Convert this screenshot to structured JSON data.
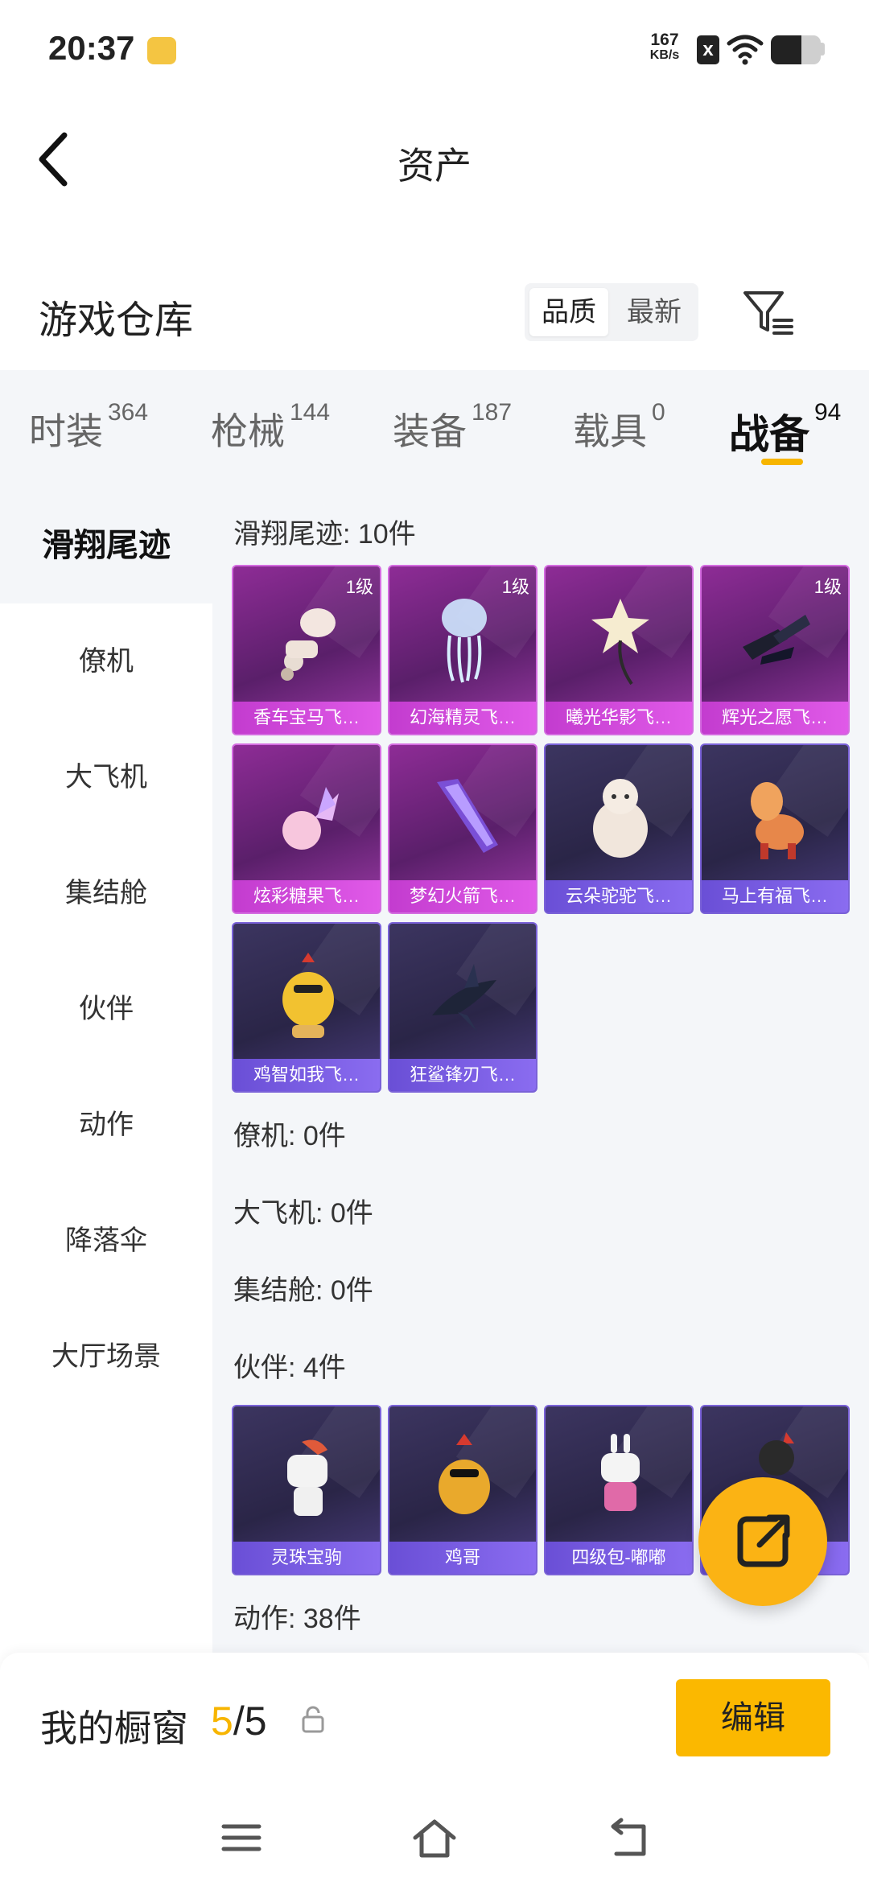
{
  "status_bar": {
    "time": "20:37",
    "net_speed_value": "167",
    "net_speed_unit": "KB/s",
    "sim_label": "x",
    "battery_level": 0.62
  },
  "header": {
    "title": "资产",
    "back_icon": "back-arrow-icon"
  },
  "warehouse": {
    "title": "游戏仓库",
    "sort_options": [
      "品质",
      "最新"
    ],
    "sort_selected": "品质",
    "filter_icon": "filter-icon"
  },
  "tabs": [
    {
      "label": "时装",
      "count": "364"
    },
    {
      "label": "枪械",
      "count": "144"
    },
    {
      "label": "装备",
      "count": "187"
    },
    {
      "label": "载具",
      "count": "0"
    },
    {
      "label": "战备",
      "count": "94"
    }
  ],
  "active_tab": "战备",
  "sidebar": {
    "items": [
      "滑翔尾迹",
      "僚机",
      "大飞机",
      "集结舱",
      "伙伴",
      "动作",
      "降落伞",
      "大厅场景"
    ],
    "active": "滑翔尾迹"
  },
  "sections": {
    "glide_trail": {
      "title": "滑翔尾迹: 10件",
      "items": [
        {
          "name": "香车宝马飞…",
          "level": "1级",
          "rarity": "purple"
        },
        {
          "name": "幻海精灵飞…",
          "level": "1级",
          "rarity": "purple"
        },
        {
          "name": "曦光华影飞…",
          "level": "",
          "rarity": "purple"
        },
        {
          "name": "辉光之愿飞…",
          "level": "1级",
          "rarity": "purple"
        },
        {
          "name": "炫彩糖果飞…",
          "level": "",
          "rarity": "purple"
        },
        {
          "name": "梦幻火箭飞…",
          "level": "",
          "rarity": "purple"
        },
        {
          "name": "云朵驼驼飞…",
          "level": "",
          "rarity": "blue"
        },
        {
          "name": "马上有福飞…",
          "level": "",
          "rarity": "blue"
        },
        {
          "name": "鸡智如我飞…",
          "level": "",
          "rarity": "blue"
        },
        {
          "name": "狂鲨锋刃飞…",
          "level": "",
          "rarity": "blue"
        }
      ]
    },
    "wingman": {
      "title": "僚机: 0件"
    },
    "big_plane": {
      "title": "大飞机: 0件"
    },
    "assembly_pod": {
      "title": "集结舱: 0件"
    },
    "partner": {
      "title": "伙伴: 4件",
      "items": [
        {
          "name": "灵珠宝驹",
          "rarity": "blue"
        },
        {
          "name": "鸡哥",
          "rarity": "blue"
        },
        {
          "name": "四级包-嘟嘟",
          "rarity": "blue"
        },
        {
          "name": "",
          "rarity": "blue"
        }
      ]
    },
    "action": {
      "title": "动作: 38件"
    }
  },
  "fab": {
    "icon": "share-out-icon"
  },
  "showcase": {
    "label": "我的橱窗",
    "current": "5",
    "separator": "/",
    "total": "5",
    "lock_icon": "lock-icon",
    "edit_label": "编辑"
  },
  "nav": {
    "menu_icon": "menu-icon",
    "home_icon": "home-icon",
    "back_icon": "back-icon"
  },
  "colors": {
    "accent": "#F7B500",
    "purple_rarity": "#D46CE0",
    "blue_rarity": "#7A62D8"
  }
}
